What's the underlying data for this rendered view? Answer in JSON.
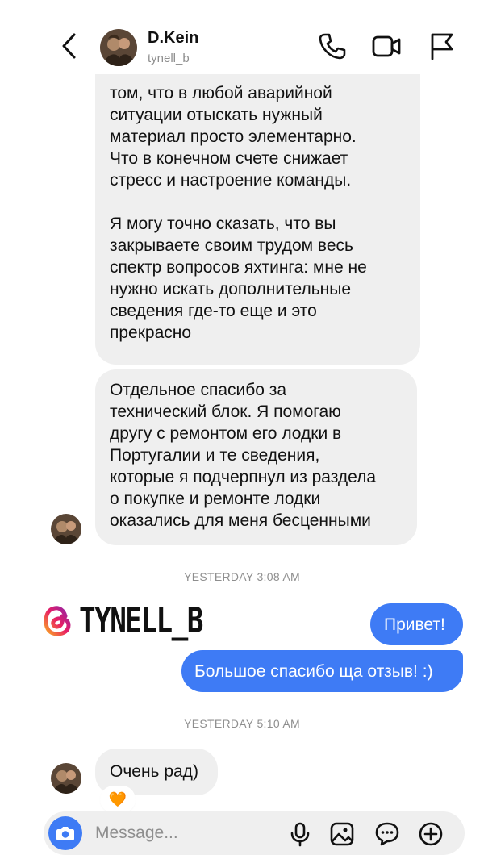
{
  "header": {
    "contact_name": "D.Kein",
    "contact_handle": "tynell_b",
    "icons": [
      "back-icon",
      "phone-icon",
      "video-icon",
      "flag-icon"
    ]
  },
  "messages": {
    "received_1": "том, что в любой аварийной\nситуации отыскать нужный\nматериал просто элементарно.\nЧто в конечном счете снижает\nстресс и настроение команды.\n\nЯ могу точно сказать, что вы\nзакрываете своим трудом весь\nспектр вопросов яхтинга: мне не\nнужно искать дополнительные\nсведения где-то еще и это\nпрекрасно",
    "received_2": "Отдельное спасибо за\nтехнический блок. Я помогаю\nдругу с ремонтом его лодки в\nПортугалии и те сведения,\nкоторые я подчерпнул из раздела\nо покупке и ремонте лодки\nоказались для меня бесценными",
    "timestamp_1": "YESTERDAY 3:08 AM",
    "sent_1": "Привет!",
    "sent_2": "Большое спасибо ща отзыв! :)",
    "timestamp_2": "YESTERDAY 5:10 AM",
    "received_3": "Очень рад)",
    "reaction": "🧡"
  },
  "watermark": {
    "handle": "TYNELL_B"
  },
  "composer": {
    "placeholder": "Message...",
    "icons": [
      "camera-icon",
      "microphone-icon",
      "image-icon",
      "sticker-icon",
      "plus-icon"
    ]
  },
  "colors": {
    "accent": "#3e7bf5",
    "bubble_gray": "#efefef",
    "muted_text": "#8e8e8e"
  }
}
